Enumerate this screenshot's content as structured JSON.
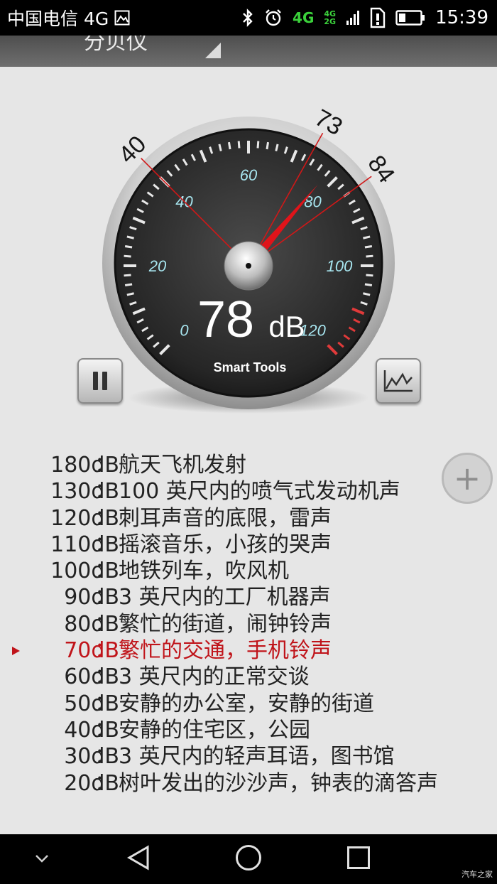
{
  "status_bar": {
    "carrier": "中国电信 4G",
    "time": "15:39",
    "net_4g": "4G",
    "net_4g_top": "4G",
    "net_2g_bottom": "2G"
  },
  "app": {
    "title": "分贝仪"
  },
  "meter": {
    "value": "78",
    "unit": "dB",
    "brand": "Smart Tools",
    "min_marker": "40",
    "avg_marker": "73",
    "max_marker": "84",
    "needle_value": 78,
    "scale_min": 0,
    "scale_max": 120,
    "scale_labels": [
      "0",
      "20",
      "40",
      "60",
      "80",
      "100",
      "120"
    ],
    "colors": {
      "face": "#2a2a2a",
      "scale_text": "#a8e6f0",
      "needle": "#e0141a",
      "marker_line": "#d01818",
      "danger_ticks": "#e03a3a"
    }
  },
  "buttons": {
    "pause_icon": "pause-icon",
    "chart_icon": "line-chart-icon",
    "plus": "+"
  },
  "references": [
    {
      "db": "180dB",
      "desc": "航天飞机发射",
      "active": false
    },
    {
      "db": "130dB",
      "desc": "100 英尺内的喷气式发动机声",
      "active": false
    },
    {
      "db": "120dB",
      "desc": "刺耳声音的底限，雷声",
      "active": false
    },
    {
      "db": "110dB",
      "desc": "摇滚音乐，小孩的哭声",
      "active": false
    },
    {
      "db": "100dB",
      "desc": "地铁列车，吹风机",
      "active": false
    },
    {
      "db": "90dB",
      "desc": "3 英尺内的工厂机器声",
      "active": false
    },
    {
      "db": "80dB",
      "desc": "繁忙的街道，闹钟铃声",
      "active": false
    },
    {
      "db": "70dB",
      "desc": "繁忙的交通，手机铃声",
      "active": true
    },
    {
      "db": "60dB",
      "desc": "3 英尺内的正常交谈",
      "active": false
    },
    {
      "db": "50dB",
      "desc": "安静的办公室，安静的街道",
      "active": false
    },
    {
      "db": "40dB",
      "desc": "安静的住宅区，公园",
      "active": false
    },
    {
      "db": "30dB",
      "desc": "3 英尺内的轻声耳语，图书馆",
      "active": false
    },
    {
      "db": "20dB",
      "desc": "树叶发出的沙沙声，钟表的滴答声",
      "active": false
    }
  ],
  "ref_colon": "：",
  "watermark": "汽车之家"
}
